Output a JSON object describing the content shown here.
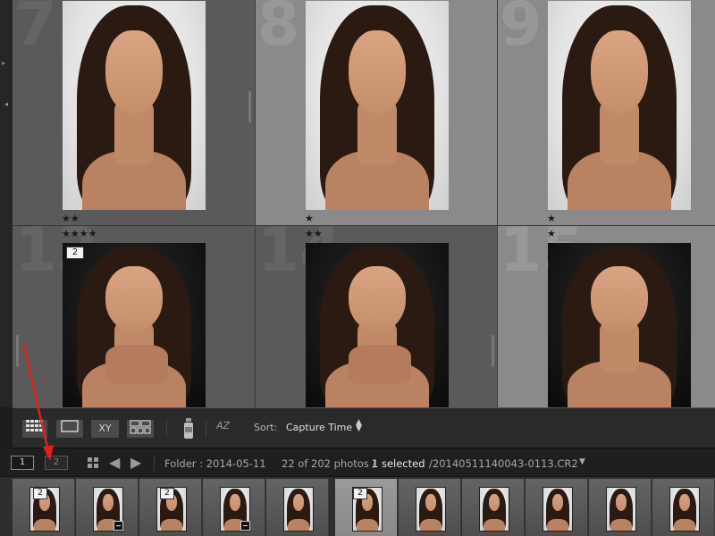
{
  "grid": {
    "cells": [
      {
        "number": "7",
        "stars": "★★",
        "shade": "dark",
        "bg": "light"
      },
      {
        "number": "8",
        "stars": "★",
        "shade": "light",
        "bg": "light"
      },
      {
        "number": "9",
        "stars": "★",
        "shade": "light",
        "bg": "light"
      },
      {
        "number": "13",
        "stars": "★★★★",
        "badge": "2",
        "shade": "dark",
        "bg": "dark"
      },
      {
        "number": "14",
        "stars": "★★",
        "shade": "dark",
        "bg": "dark"
      },
      {
        "number": "15",
        "stars": "★",
        "shade": "light",
        "bg": "dark"
      }
    ]
  },
  "toolbar": {
    "grid_view_icon": "grid-icon",
    "loupe_view_icon": "loupe-icon",
    "compare_label": "XY",
    "survey_view_icon": "survey-icon",
    "painter_icon": "spray-can-icon",
    "sort_direction_label": "AZ",
    "sort_label": "Sort:",
    "sort_value": "Capture Time",
    "sort_arrows": "▲▼"
  },
  "statusbar": {
    "screen_1": "1",
    "screen_2": "2",
    "folder": "Folder : 2014-05-11",
    "count": "22 of 202 photos /",
    "selected": "1 selected",
    "filename": "/20140511140043-0113.CR2",
    "caret": "▼"
  },
  "filmstrip": {
    "items": [
      {
        "badge": "2",
        "bg": "light",
        "adjusted": false,
        "selected": false
      },
      {
        "badge": "",
        "bg": "light",
        "adjusted": true,
        "selected": false
      },
      {
        "badge": "2",
        "bg": "light",
        "adjusted": false,
        "selected": false
      },
      {
        "badge": "",
        "bg": "light",
        "adjusted": true,
        "selected": false
      },
      {
        "badge": "",
        "bg": "light",
        "adjusted": false,
        "selected": false
      },
      {
        "badge": "2",
        "bg": "light",
        "adjusted": false,
        "selected": true
      },
      {
        "badge": "",
        "bg": "light",
        "adjusted": false,
        "selected": false
      },
      {
        "badge": "",
        "bg": "light",
        "adjusted": false,
        "selected": false
      },
      {
        "badge": "",
        "bg": "light",
        "adjusted": false,
        "selected": false
      },
      {
        "badge": "",
        "bg": "light",
        "adjusted": false,
        "selected": false
      },
      {
        "badge": "",
        "bg": "light",
        "adjusted": false,
        "selected": false
      }
    ]
  },
  "colors": {
    "annotation": "#e02020",
    "panel": "#2a2a2a",
    "cell_dark": "#5a5a5a",
    "cell_light": "#8a8a8a"
  }
}
